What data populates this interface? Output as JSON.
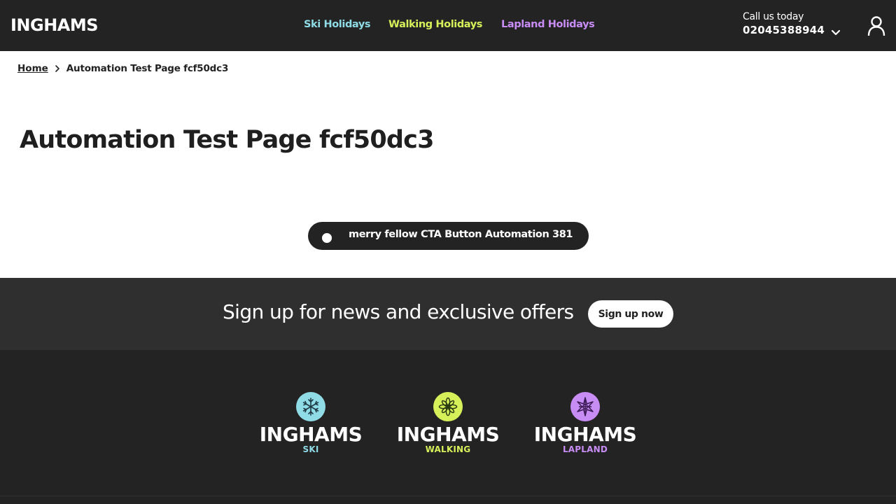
{
  "header": {
    "logo": "INGHAMS",
    "nav": {
      "ski": "Ski Holidays",
      "walking": "Walking Holidays",
      "lapland": "Lapland Holidays"
    },
    "call_label": "Call us today",
    "call_number": "02045388944"
  },
  "breadcrumb": {
    "home": "Home",
    "current": "Automation Test Page fcf50dc3"
  },
  "page": {
    "title": "Automation Test Page fcf50dc3",
    "cta_label": "merry fellow CTA Button Automation 381"
  },
  "signup": {
    "text": "Sign up for news and exclusive offers",
    "button": "Sign up now"
  },
  "footer": {
    "brands": [
      {
        "name": "INGHAMS",
        "sub": "SKI",
        "color": "#8fdbe6",
        "icon": "snowflake-icon"
      },
      {
        "name": "INGHAMS",
        "sub": "WALKING",
        "color": "#d6f05a",
        "icon": "flower-icon"
      },
      {
        "name": "INGHAMS",
        "sub": "LAPLAND",
        "color": "#c88cf5",
        "icon": "star-icon"
      }
    ]
  },
  "colors": {
    "header_bg": "#232323",
    "signup_bg": "#2f2f2f",
    "ski": "#8fdbe6",
    "walking": "#d6f05a",
    "lapland": "#c88cf5"
  }
}
